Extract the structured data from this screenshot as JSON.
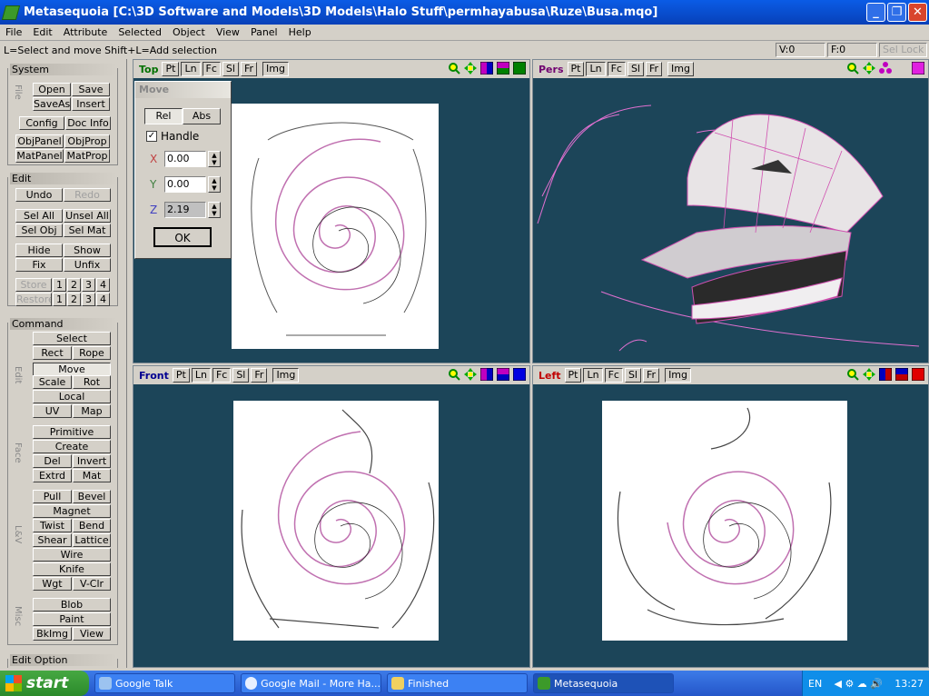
{
  "window": {
    "title": "Metasequoia [C:\\3D Software and Models\\3D Models\\Halo Stuff\\permhayabusa\\Ruze\\Busa.mqo]"
  },
  "menu": [
    "File",
    "Edit",
    "Attribute",
    "Selected",
    "Object",
    "View",
    "Panel",
    "Help"
  ],
  "status": {
    "hint": "L=Select and move  Shift+L=Add selection",
    "v": "V:0",
    "f": "F:0",
    "sel_lock": "Sel Lock"
  },
  "sidebar": {
    "system": {
      "title": "System",
      "side": "File",
      "buttons": [
        "Open",
        "Save",
        "SaveAs",
        "Insert",
        "Config",
        "Doc Info",
        "ObjPanel",
        "ObjProp",
        "MatPanel",
        "MatProp"
      ]
    },
    "edit": {
      "title": "Edit",
      "buttons": [
        "Undo",
        "Redo",
        "Sel All",
        "Unsel All",
        "Sel Obj",
        "Sel Mat",
        "Hide",
        "Show",
        "Fix",
        "Unfix",
        "Store",
        "Restore"
      ],
      "nums": [
        "1",
        "2",
        "3",
        "4"
      ]
    },
    "command": {
      "title": "Command",
      "edit_side": "Edit",
      "face_side": "Face",
      "lv_side": "L&V",
      "misc_side": "Misc",
      "edit_btns": [
        "Select",
        "Rect",
        "Rope",
        "Move",
        "Scale",
        "Rot",
        "Local",
        "UV",
        "Map"
      ],
      "face_btns": [
        "Primitive",
        "Create",
        "Del",
        "Invert",
        "Extrd",
        "Mat"
      ],
      "lv_btns": [
        "Pull",
        "Bevel",
        "Magnet",
        "Twist",
        "Bend",
        "Shear",
        "Lattice",
        "Wire",
        "Knife",
        "Wgt",
        "V-Clr"
      ],
      "misc_btns": [
        "Blob",
        "Paint",
        "BkImg",
        "View"
      ]
    },
    "edit_option": {
      "title": "Edit Option"
    }
  },
  "move_panel": {
    "title": "Move",
    "rel": "Rel",
    "abs": "Abs",
    "handle": "Handle",
    "x_label": "X",
    "y_label": "Y",
    "z_label": "Z",
    "x": "0.00",
    "y": "0.00",
    "z": "2.19",
    "ok": "OK"
  },
  "viewports": {
    "top": {
      "name": "Top",
      "btns": [
        "Pt",
        "Ln",
        "Fc",
        "Sl",
        "Fr",
        "Img"
      ]
    },
    "pers": {
      "name": "Pers",
      "btns": [
        "Pt",
        "Ln",
        "Fc",
        "Sl",
        "Fr",
        "Img"
      ]
    },
    "front": {
      "name": "Front",
      "btns": [
        "Pt",
        "Ln",
        "Fc",
        "Sl",
        "Fr",
        "Img"
      ]
    },
    "left": {
      "name": "Left",
      "btns": [
        "Pt",
        "Ln",
        "Fc",
        "Sl",
        "Fr",
        "Img"
      ]
    }
  },
  "taskbar": {
    "start": "start",
    "tasks": [
      "Google Talk",
      "Google Mail - More Ha...",
      "Finished",
      "Metasequoia"
    ],
    "lang": "EN",
    "time": "13:27"
  },
  "colors": {
    "viewport_bg": "#1c4559",
    "top_label": "#007000",
    "pers_label": "#700070",
    "front_label": "#000090",
    "left_label": "#c00000"
  }
}
